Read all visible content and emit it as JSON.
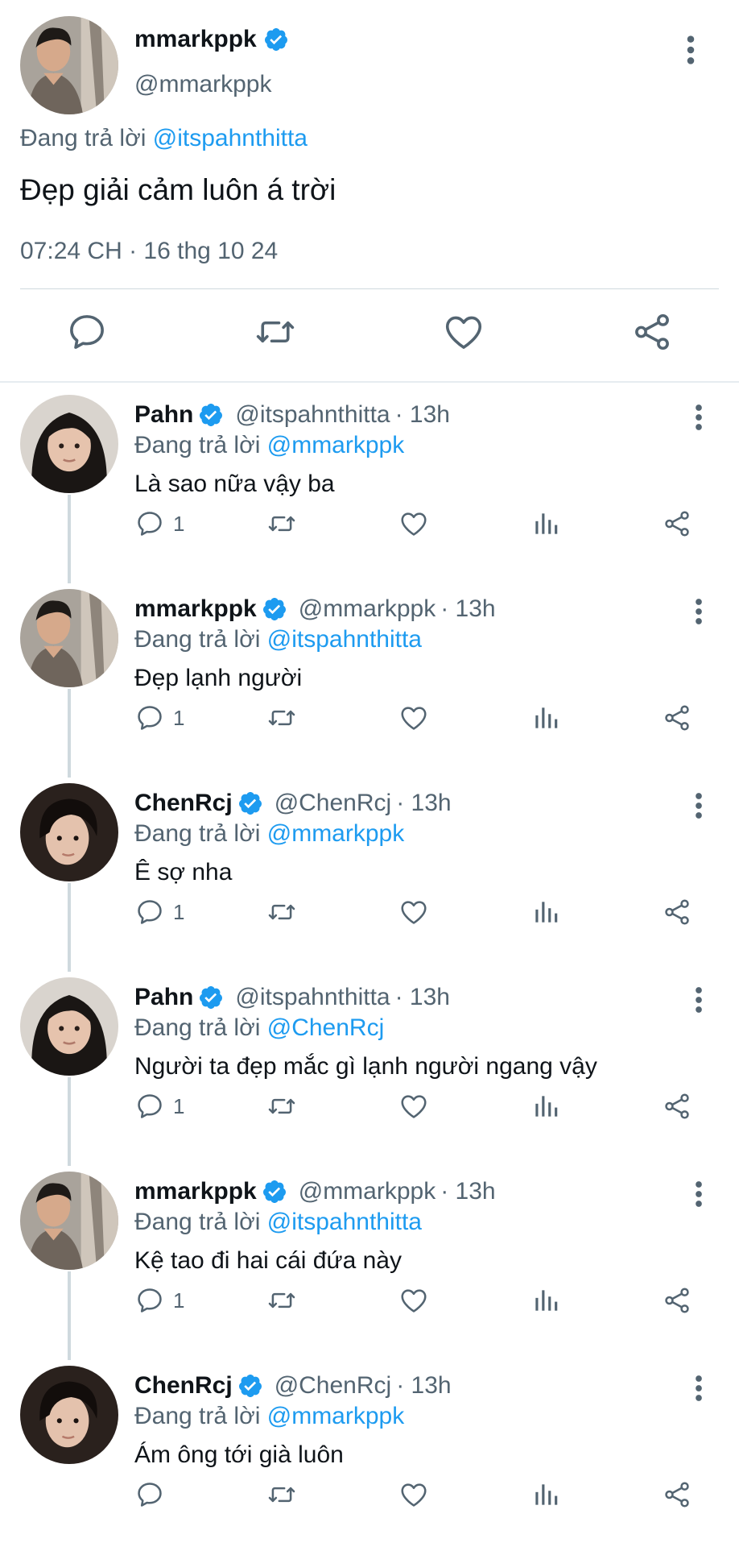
{
  "main": {
    "name": "mmarkppk",
    "handle": "@mmarkppk",
    "reply_prefix": "Đang trả lời",
    "reply_to": "@itspahnthitta",
    "text": "Đẹp giải cảm luôn á trời",
    "timestamp": "07:24 CH · 16 thg 10 24",
    "actions": [
      "reply-icon",
      "retweet-icon",
      "like-icon",
      "share-icon"
    ]
  },
  "colors": {
    "accent": "#1d9bf0",
    "secondary_text": "#536471",
    "primary_text": "#0f1419",
    "divider": "#cfd9de"
  },
  "replies": [
    {
      "name": "Pahn",
      "handle": "@itspahnthitta",
      "time": "· 13h",
      "reply_prefix": "Đang trả lời",
      "reply_to": "@mmarkppk",
      "text": "Là sao nữa vậy ba",
      "reply_count": "1"
    },
    {
      "name": "mmarkppk",
      "handle": "@mmarkppk",
      "time": "· 13h",
      "reply_prefix": "Đang trả lời",
      "reply_to": "@itspahnthitta",
      "text": "Đẹp lạnh người",
      "reply_count": "1"
    },
    {
      "name": "ChenRcj",
      "handle": "@ChenRcj",
      "time": "· 13h",
      "reply_prefix": "Đang trả lời",
      "reply_to": "@mmarkppk",
      "text": "Ê sợ nha",
      "reply_count": "1"
    },
    {
      "name": "Pahn",
      "handle": "@itspahnthitta",
      "time": "· 13h",
      "reply_prefix": "Đang trả lời",
      "reply_to": "@ChenRcj",
      "text": "Người ta đẹp mắc gì lạnh người ngang vậy",
      "reply_count": "1"
    },
    {
      "name": "mmarkppk",
      "handle": "@mmarkppk",
      "time": "· 13h",
      "reply_prefix": "Đang trả lời",
      "reply_to": "@itspahnthitta",
      "text": "Kệ tao đi hai cái đứa này",
      "reply_count": "1"
    },
    {
      "name": "ChenRcj",
      "handle": "@ChenRcj",
      "time": "· 13h",
      "reply_prefix": "Đang trả lời",
      "reply_to": "@mmarkppk",
      "text": "Ám ông tới già luôn",
      "reply_count": ""
    }
  ]
}
